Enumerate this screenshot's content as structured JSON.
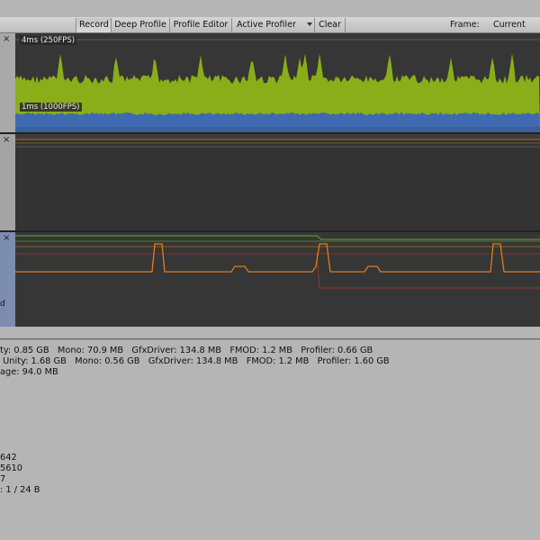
{
  "toolbar": {
    "record": "Record",
    "deep_profile": "Deep Profile",
    "profile_editor": "Profile Editor",
    "active_profiler": "Active Profiler",
    "clear": "Clear",
    "frame_label": "Frame:",
    "frame_value": "Current"
  },
  "cpu_chart": {
    "label_top": "4ms (250FPS)",
    "label_mid": "1ms (1000FPS)",
    "colors": {
      "rendering": "#8aae1a",
      "scripts": "#3e6ab1"
    }
  },
  "bottom_chart": {
    "left_fragment": "d",
    "colors": {
      "line_orange": "#e07b1e",
      "line_green": "#5d9e2c",
      "line_red": "#c0392b"
    }
  },
  "close_glyph": "×",
  "memory": {
    "line1": "ty: 0.85 GB   Mono: 70.9 MB   GfxDriver: 134.8 MB   FMOD: 1.2 MB   Profiler: 0.66 GB",
    "line2": " Unity: 1.68 GB   Mono: 0.56 GB   GfxDriver: 134.8 MB   FMOD: 1.2 MB   Profiler: 1.60 GB",
    "line3": "age: 94.0 MB",
    "line4": "642",
    "line5": "5610",
    "line6": "7",
    "line7": ": 1 / 24 B"
  }
}
